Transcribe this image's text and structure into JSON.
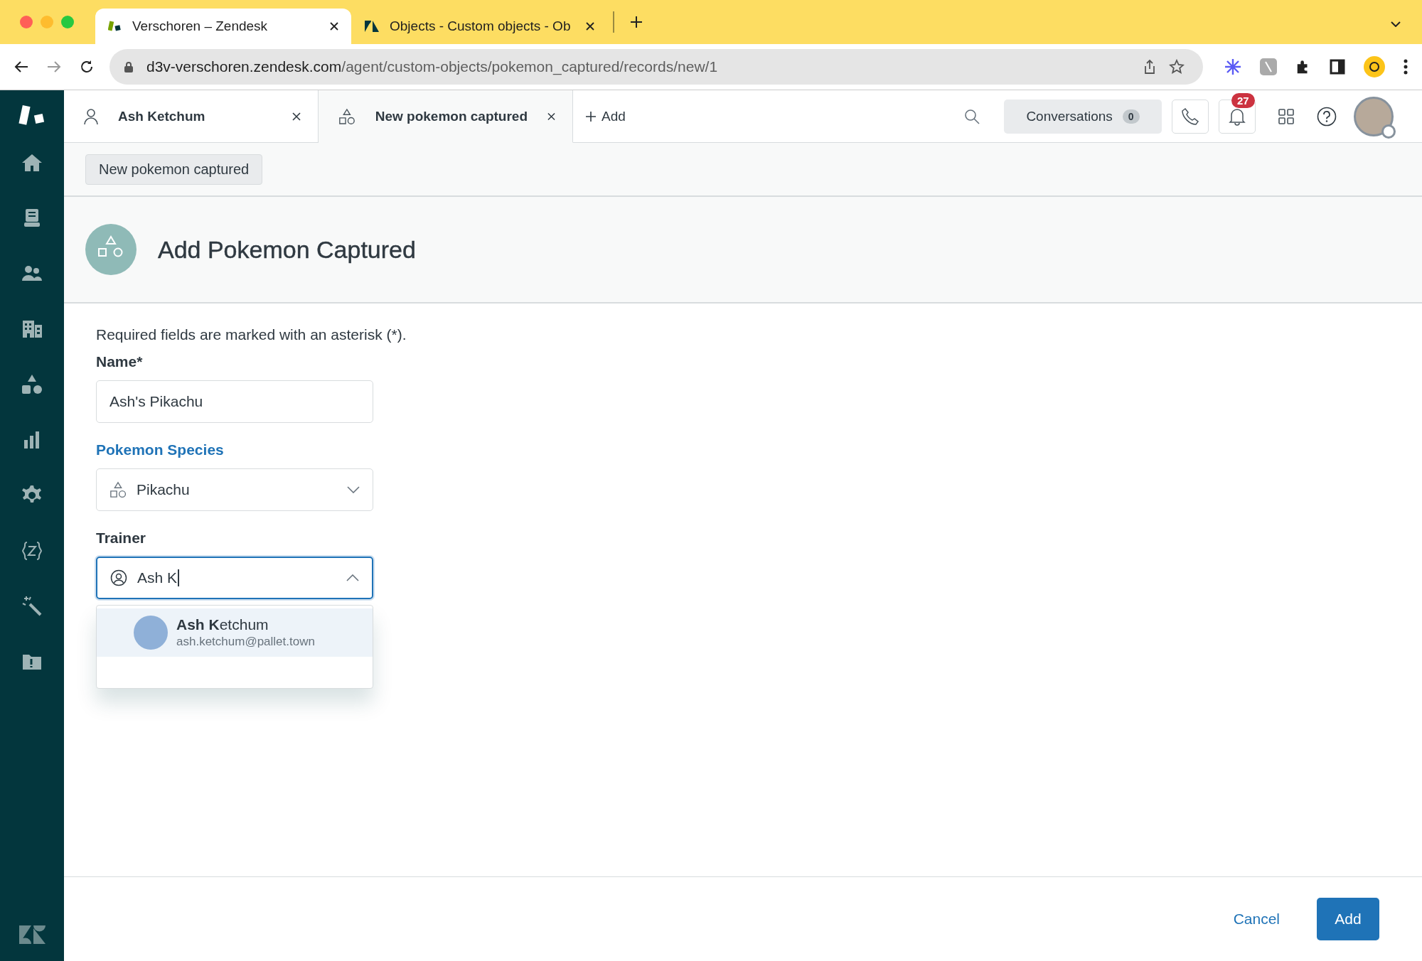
{
  "browser": {
    "tabs": [
      {
        "title": "Verschoren – Zendesk",
        "selected": true
      },
      {
        "title": "Objects - Custom objects - Ob",
        "selected": false
      }
    ],
    "url": {
      "host": "d3v-verschoren.zendesk.com",
      "path": "/agent/custom-objects/pokemon_captured/records/new/1"
    }
  },
  "app_tabs": [
    {
      "label": "Ash Ketchum",
      "kind": "user",
      "selected": false
    },
    {
      "label": "New pokemon captured",
      "kind": "object",
      "selected": true
    }
  ],
  "add_tab": "Add",
  "header": {
    "conversations": {
      "label": "Conversations",
      "count": "0"
    },
    "notifications": "27"
  },
  "breadcrumb": "New pokemon captured",
  "page_title": "Add Pokemon Captured",
  "form": {
    "note": "Required fields are marked with an asterisk (*).",
    "fields": [
      {
        "label": "Name*",
        "kind": "text",
        "value": "Ash's Pikachu",
        "focused": false,
        "linked": false
      },
      {
        "label": "Pokemon Species",
        "kind": "select",
        "value": "Pikachu",
        "focused": false,
        "linked": true
      },
      {
        "label": "Trainer",
        "kind": "autocomplete",
        "value": "Ash K",
        "focused": true,
        "linked": false,
        "expanded": true,
        "options": [
          {
            "name": "**Ash K**etchum",
            "email": "ash.ketchum@pallet.town",
            "selected": true
          }
        ]
      }
    ]
  },
  "footer": {
    "buttons": [
      {
        "label": "Cancel",
        "kind": "link"
      },
      {
        "label": "Add",
        "kind": "primary"
      }
    ]
  }
}
